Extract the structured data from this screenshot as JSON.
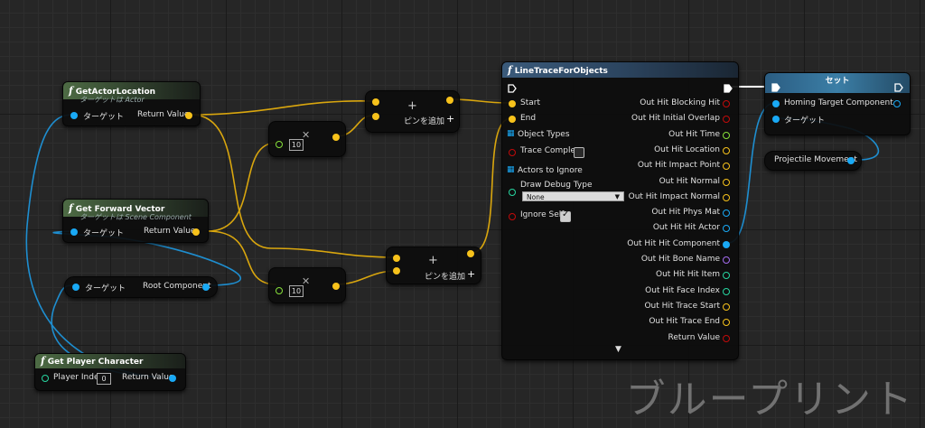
{
  "colors": {
    "object_pin": "#19a9f5",
    "vector_pin": "#f7c21b",
    "bool_pin": "#c20a0a",
    "float_pin": "#87e03a",
    "name_pin": "#a46cf0",
    "teal_pin": "#27d6a0"
  },
  "nodes": {
    "get_actor_location": {
      "title": "GetActorLocation",
      "subtitle": "ターゲットは Actor",
      "in_pin": "ターゲット",
      "out_pin": "Return Value"
    },
    "get_forward_vector": {
      "title": "Get Forward Vector",
      "subtitle": "ターゲットは Scene Component",
      "in_pin": "ターゲット",
      "out_pin": "Return Value"
    },
    "root_component": {
      "in_pin": "ターゲット",
      "out_pin": "Root Component"
    },
    "get_player_character": {
      "title": "Get Player Character",
      "in_pin": "Player Index",
      "index_value": "0",
      "out_pin": "Return Value"
    },
    "multiply_top": {
      "value": "10",
      "icon": "multiply-icon"
    },
    "multiply_bottom": {
      "value": "10",
      "icon": "multiply-icon"
    },
    "add_top": {
      "add_pin": "ピンを追加"
    },
    "add_bottom": {
      "add_pin": "ピンを追加"
    },
    "line_trace": {
      "title": "LineTraceForObjects",
      "inputs": [
        "Start",
        "End",
        "Object Types",
        "Trace Complex",
        "Actors to Ignore",
        "Draw Debug Type",
        "Ignore Self"
      ],
      "draw_debug_value": "None",
      "trace_complex_checked": false,
      "ignore_self_checked": true,
      "outputs": [
        "Out Hit Blocking Hit",
        "Out Hit Initial Overlap",
        "Out Hit Time",
        "Out Hit Location",
        "Out Hit Impact Point",
        "Out Hit Normal",
        "Out Hit Impact Normal",
        "Out Hit Phys Mat",
        "Out Hit Hit Actor",
        "Out Hit Hit Component",
        "Out Hit Bone Name",
        "Out Hit Hit Item",
        "Out Hit Face Index",
        "Out Hit Trace Start",
        "Out Hit Trace End",
        "Return Value"
      ]
    },
    "set_node": {
      "title": "セット",
      "in_pins": [
        "Homing Target Component",
        "ターゲット"
      ]
    },
    "projectile_movement": {
      "label": "Projectile Movement"
    }
  },
  "watermark": "ブループリント"
}
